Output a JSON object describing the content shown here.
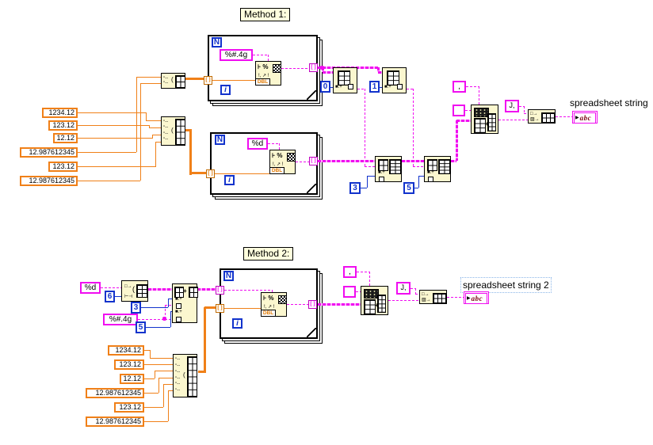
{
  "m1": {
    "title": "Method 1:",
    "constants": [
      "1234.12",
      "123.12",
      "12.12",
      "12.987612345",
      "123.12",
      "12.987612345"
    ],
    "fmt_float": "%#.4g",
    "fmt_int": "%d",
    "n": "N",
    "i": "i",
    "dbl": "DBL",
    "idx": [
      "0",
      "1"
    ],
    "ins_pos": [
      "3",
      "5"
    ],
    "delim": ",",
    "empty": "",
    "eol": "J,",
    "out_label": "spreadsheet string",
    "out_value": "abc"
  },
  "m2": {
    "title": "Method 2:",
    "fmt_int": "%d",
    "array_size": "6",
    "replace_pos": [
      "3",
      "5"
    ],
    "fmt_float": "%#.4g",
    "constants": [
      "1234.12",
      "123.12",
      "12.12",
      "12.987612345",
      "123.12",
      "12.987612345"
    ],
    "n": "N",
    "i": "i",
    "dbl": "DBL",
    "delim": ",",
    "empty": "",
    "eol": "J,",
    "out_label": "spreadsheet string 2",
    "out_value": "abc"
  },
  "glyphs": {
    "tunnel": "[]",
    "elem_index": "■.+",
    "square": "□",
    "plus": "+",
    "paren": "(",
    "dim_size": "⊢⊣",
    "fmt_top": "⊦ %",
    "fmt_bot": "!, ↗ !",
    "array_row": "▫‥",
    "init_row": "□→",
    "concat_row1": "□→",
    "concat_row2": "▨→",
    "indicator_arrow": "▶"
  },
  "colors": {
    "string_pink": "#F00CF0",
    "numeric_orange": "#F08018",
    "int_blue": "#1233CC",
    "node_yellow": "#FBF7CF"
  }
}
